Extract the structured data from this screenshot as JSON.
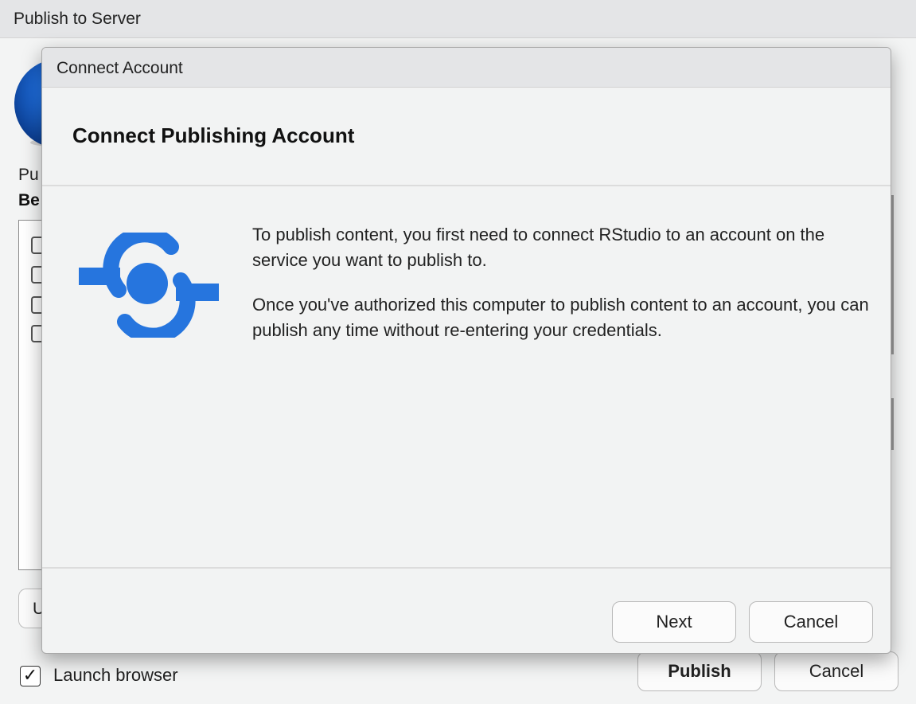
{
  "outer_window": {
    "title": "Publish to Server",
    "partial_text_1": "Pu",
    "partial_text_2": "Be",
    "partial_button_label": "U",
    "launch_browser_checked_glyph": "✓",
    "launch_browser_label": "Launch browser",
    "publish_label": "Publish",
    "cancel_label": "Cancel"
  },
  "dialog": {
    "title": "Connect Account",
    "heading": "Connect Publishing Account",
    "icon": "connect-service-icon",
    "paragraph_1": "To publish content, you first need to connect RStudio to an account on the service you want to publish to.",
    "paragraph_2": "Once you've authorized this computer to publish content to an account, you can publish any time without re-entering your credentials.",
    "next_label": "Next",
    "cancel_label": "Cancel"
  },
  "colors": {
    "accent_blue": "#2675de"
  }
}
